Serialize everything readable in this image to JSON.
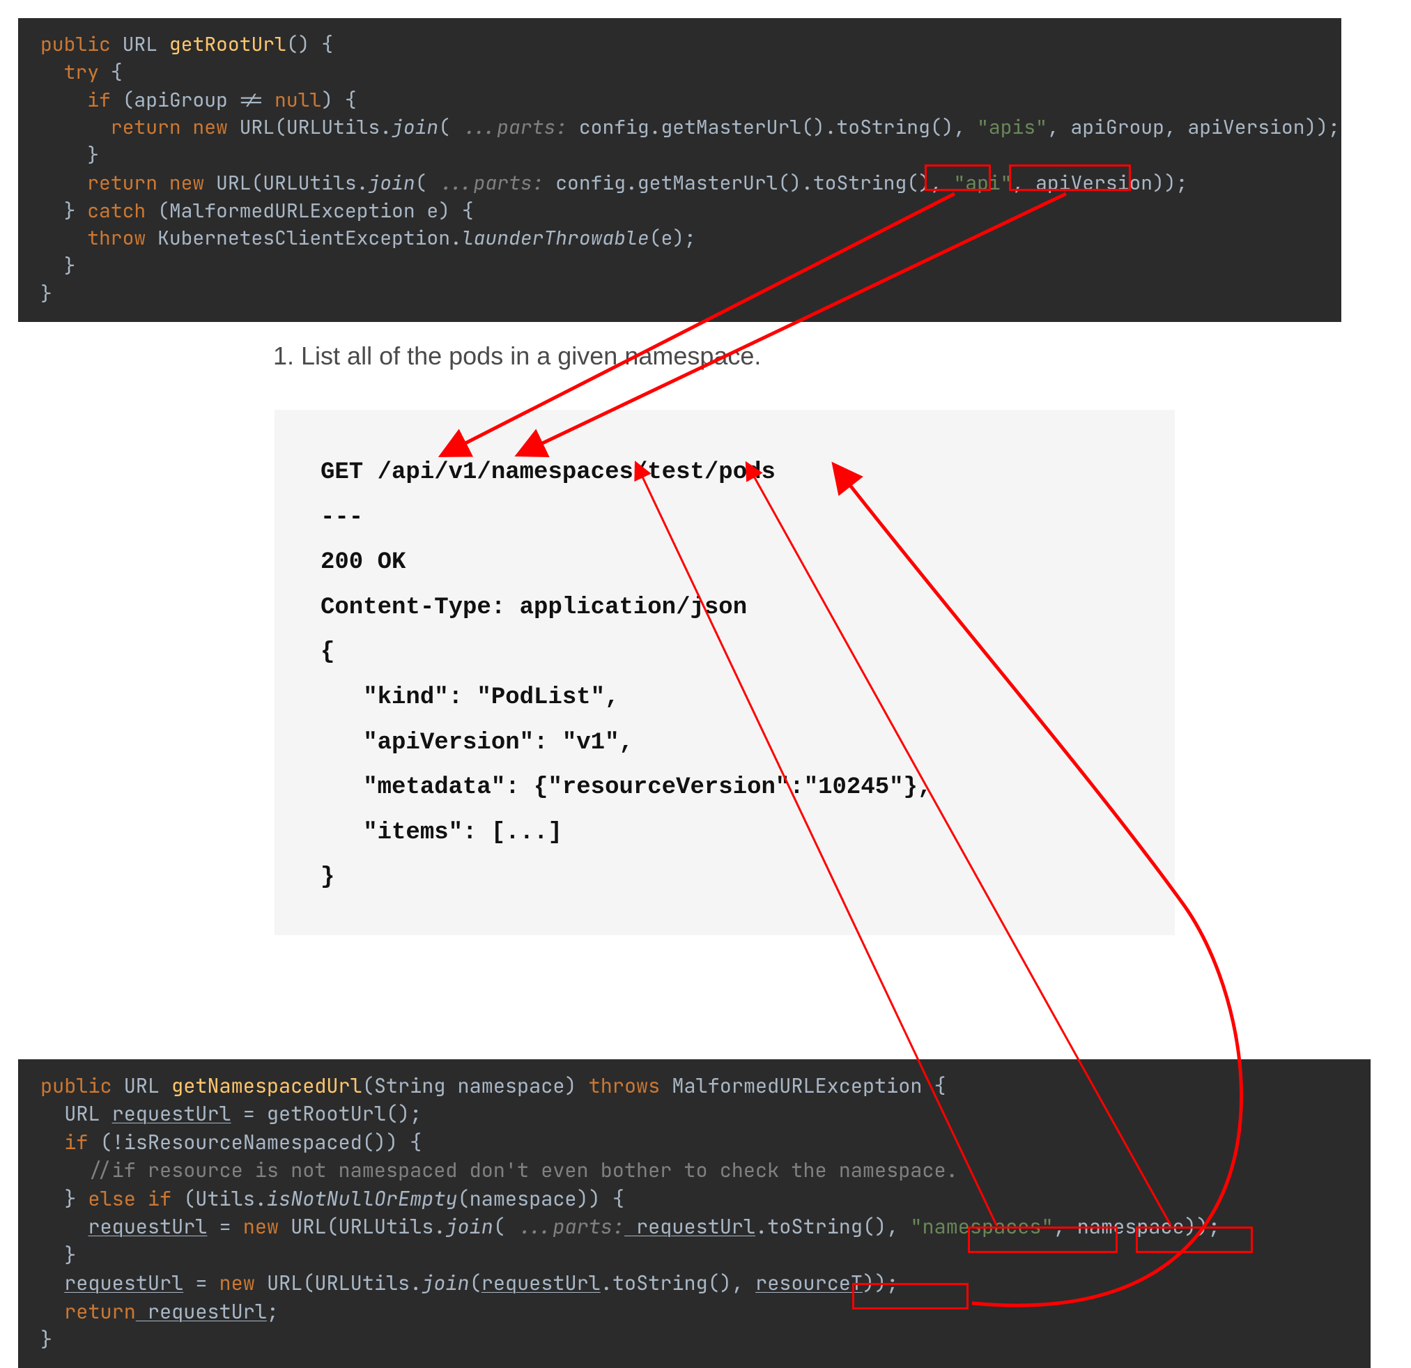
{
  "code_top": {
    "l1_public": "public",
    "l1_url": "URL",
    "l1_fn": "getRootUrl",
    "l1_rest": "() {",
    "l2_try": "try",
    "l2_brace": " {",
    "l3_if": "if",
    "l3_rest": " (apiGroup != ",
    "l3_null": "null",
    "l3_rest2": ") {",
    "l4_return": "return new",
    "l4_rest": " URL(URLUtils.",
    "l4_join": "join",
    "l4_hint": " ...parts:",
    "l4_rest2": " config.getMasterUrl().toString(), ",
    "l4_s1": "\"apis\"",
    "l4_rest3": ", apiGroup, apiVersion));",
    "l5_brace": "}",
    "l6_return": "return new",
    "l6_rest": " URL(URLUtils.",
    "l6_join": "join",
    "l6_hint": " ...parts:",
    "l6_rest2": " config.getMasterUrl().toString(), ",
    "l6_s1": "\"api\"",
    "l6_rest3": ", apiVersion));",
    "l7_brace": "} ",
    "l7_catch": "catch",
    "l7_rest": " (MalformedURLException e) {",
    "l8_throw": "throw",
    "l8_rest": " KubernetesClientException.",
    "l8_fn": "launderThrowable",
    "l8_rest2": "(e);",
    "l9": "}",
    "l10": "}"
  },
  "heading": "1. List all of the pods in a given namespace.",
  "http": {
    "body": "GET /api/v1/namespaces/test/pods\n---\n200 OK\nContent-Type: application/json\n{\n   \"kind\": \"PodList\",\n   \"apiVersion\": \"v1\",\n   \"metadata\": {\"resourceVersion\":\"10245\"},\n   \"items\": [...]\n}"
  },
  "code_bottom": {
    "l1_public": "public",
    "l1_rest": " URL ",
    "l1_fn": "getNamespacedUrl",
    "l1_rest2": "(String namespace) ",
    "l1_throws": "throws",
    "l1_rest3": " MalformedURLException {",
    "l2_a": "URL ",
    "l2_u": "requestUrl",
    "l2_b": " = getRootUrl();",
    "l3_if": "if",
    "l3_rest": " (!isResourceNamespaced()) {",
    "l4_cmnt": "//if resource is not namespaced don't even bother to check the namespace.",
    "l5_a": "} ",
    "l5_else": "else if",
    "l5_b": " (Utils.",
    "l5_fn": "isNotNullOrEmpty",
    "l5_c": "(namespace)) {",
    "l6_u": "requestUrl",
    "l6_a": " = ",
    "l6_new": "new",
    "l6_b": " URL(URLUtils.",
    "l6_join": "join",
    "l6_hint": " ...parts:",
    "l6_u2": " requestUrl",
    "l6_c": ".toString(), ",
    "l6_s": "\"namespaces\"",
    "l6_d": ", namespace));",
    "l7": "}",
    "l8_u": "requestUrl",
    "l8_a": " = ",
    "l8_new": "new",
    "l8_b": " URL(URLUtils.",
    "l8_join": "join",
    "l8_c": "(",
    "l8_u2": "requestUrl",
    "l8_d": ".toString(), ",
    "l8_u3": "resourceT",
    "l8_e": "));",
    "l9_return": "return",
    "l9_u": " requestUrl",
    "l9_a": ";",
    "l10": "}"
  },
  "boxes": {
    "api": "\"api\"",
    "apiVersion": "apiVersion",
    "namespaces": "\"namespaces\"",
    "namespace": "namespace",
    "resourceT": "resourceT"
  }
}
